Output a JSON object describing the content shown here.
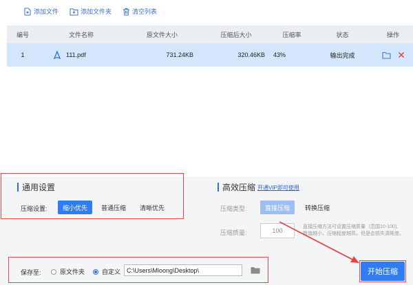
{
  "toolbar": {
    "add_file": "添加文件",
    "add_folder": "添加文件夹",
    "clear_list": "清空列表"
  },
  "table": {
    "headers": [
      "编号",
      "文件名称",
      "原文件大小",
      "压缩后大小",
      "压缩率",
      "状态",
      "操作"
    ],
    "rows": [
      {
        "no": "1",
        "name": "111.pdf",
        "orig_size": "731.24KB",
        "comp_size": "320.46KB",
        "ratio": "43%",
        "status": "输出完成"
      }
    ]
  },
  "general": {
    "title": "通用设置",
    "label": "压缩设置:",
    "options": [
      "缩小优先",
      "普通压缩",
      "清晰优先"
    ],
    "selected": "缩小优先"
  },
  "advanced": {
    "title": "高效压缩",
    "vip_link": "开通VIP即可使用",
    "type_label": "压缩类型:",
    "type_options": [
      "直接压缩",
      "转换压缩"
    ],
    "selected_type": "直接压缩",
    "quality_label": "压缩质量:",
    "quality_value": "100",
    "desc_line1": "直接压缩方法可设置压缩质量（范围10-100),",
    "desc_line2": "数值越小，压缩程度越高，但是会损失清晰度。"
  },
  "save": {
    "label": "保存至:",
    "opt_source": "原文件夹",
    "opt_custom": "自定义",
    "selected": "自定义",
    "path": "C:\\Users\\Mloong\\Desktop\\"
  },
  "start_button": "开始压缩",
  "colors": {
    "accent": "#2f7cf5",
    "row_highlight": "#d3e6fb",
    "annotation": "#e04848",
    "delete": "#e53935"
  }
}
